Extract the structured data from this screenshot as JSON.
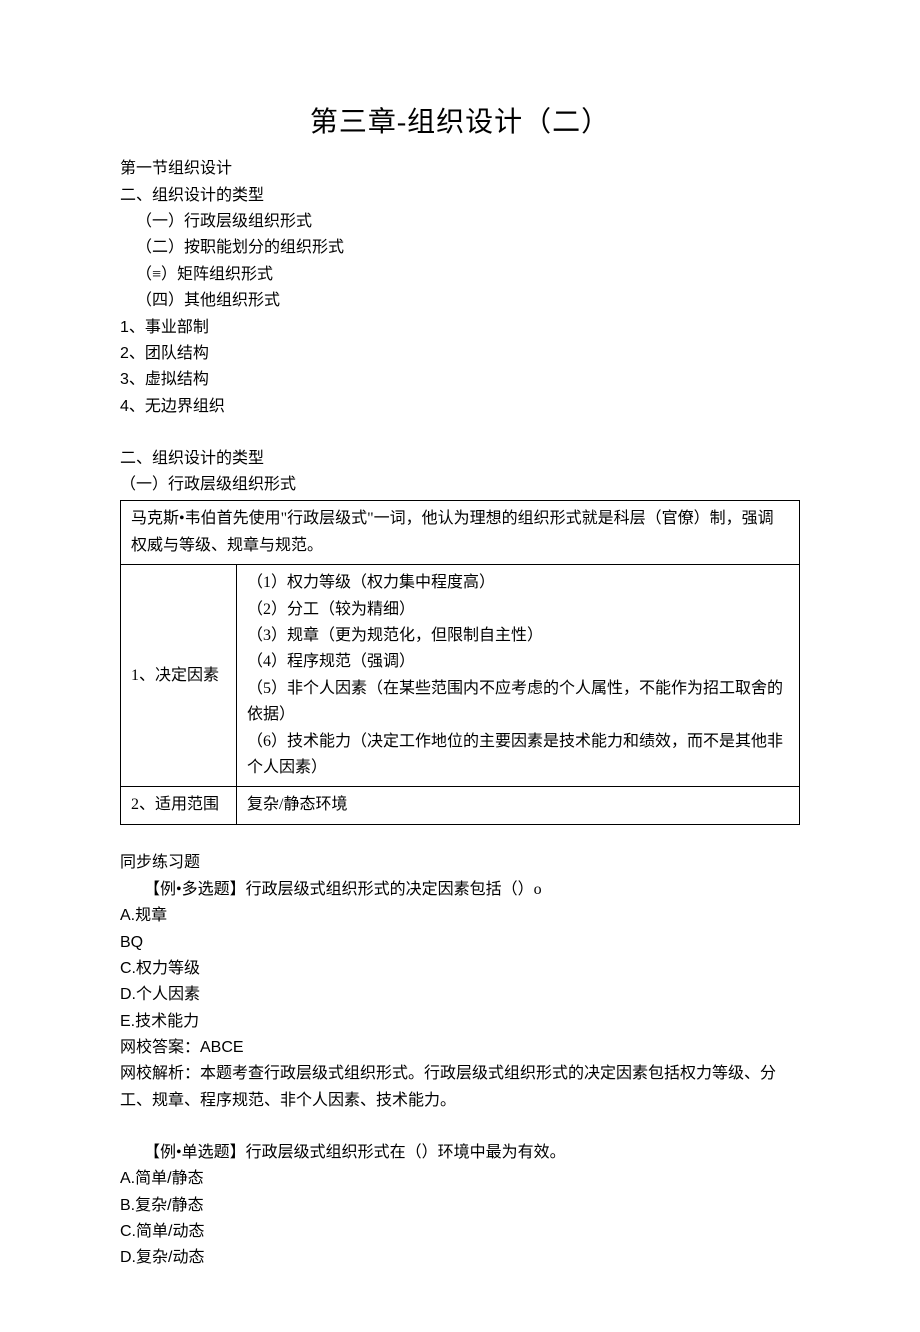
{
  "title": "第三章-组织设计（二）",
  "section1": "第一节组织设计",
  "heading2a": "二、组织设计的类型",
  "sub1": "（一）行政层级组织形式",
  "sub2": "（二）按职能划分的组织形式",
  "sub3": "（≡）矩阵组织形式",
  "sub4": "（四）其他组织形式",
  "num1": "1、事业部制",
  "num2": "2、团队结构",
  "num3": "3、虚拟结构",
  "num4": "4、无边界组织",
  "heading2b": "二、组织设计的类型",
  "sub1b": "（一）行政层级组织形式",
  "tbl": {
    "intro": "马克斯•韦伯首先使用\"行政层级式\"一词，他认为理想的组织形式就是科层（官僚）制，强调权威与等级、规章与规范。",
    "row1label": "1、决定因素",
    "r1l1": "（1）权力等级（权力集中程度高）",
    "r1l2": "（2）分工（较为精细）",
    "r1l3": "（3）规章（更为规范化，但限制自主性）",
    "r1l4": "（4）程序规范（强调）",
    "r1l5": "（5）非个人因素（在某些范围内不应考虑的个人属性，不能作为招工取舍的依据）",
    "r1l6": "（6）技术能力（决定工作地位的主要因素是技术能力和绩效，而不是其他非个人因素）",
    "row2label": "2、适用范围",
    "row2val": "复杂/静态环境"
  },
  "exHeader": "同步练习题",
  "q1": {
    "stem": "【例•多选题】行政层级式组织形式的决定因素包括（）o",
    "A": "A.规章",
    "B": "BQ",
    "C": "C.权力等级",
    "D": "D.个人因素",
    "E": "E.技术能力",
    "ans": "网校答案：ABCE",
    "exp": "网校解析：本题考查行政层级式组织形式。行政层级式组织形式的决定因素包括权力等级、分工、规章、程序规范、非个人因素、技术能力。"
  },
  "q2": {
    "stem": "【例•单选题】行政层级式组织形式在（）环境中最为有效。",
    "A": "A.简单/静态",
    "B": "B.复杂/静态",
    "C": "C.简单/动态",
    "D": "D.复杂/动态"
  }
}
